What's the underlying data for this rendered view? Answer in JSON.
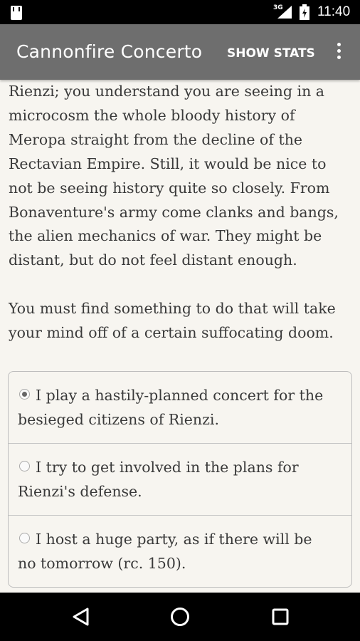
{
  "status_bar": {
    "time": "11:40",
    "network_type": "3G",
    "icons": [
      "sim-card-icon",
      "signal-icon",
      "battery-icon"
    ]
  },
  "app_bar": {
    "title": "Cannonfire Concerto",
    "show_stats_label": "SHOW STATS",
    "overflow_icon": "more-vert-icon",
    "background": "#6e6e6e"
  },
  "story": {
    "paragraphs": [
      [
        "Rienzi; you understand you are seeing in a",
        "microcosm the whole bloody history of",
        "Meropa straight from the decline of the",
        "Rectavian Empire. Still, it would be nice to",
        "not be seeing history quite so closely. From",
        "Bonaventure's army come clanks and bangs,",
        "the alien mechanics of war. They might be",
        "distant, but do not feel distant enough."
      ],
      [
        "You must find something to do that will take",
        "your mind off of a certain suffocating doom."
      ]
    ]
  },
  "choices": [
    {
      "line1": "I play a hastily-planned concert for the",
      "line2": "besieged citizens of Rienzi.",
      "selected": true
    },
    {
      "line1": "I try to get involved in the plans for",
      "line2": "Rienzi's defense.",
      "selected": false
    },
    {
      "line1": "I host a huge party, as if there will be",
      "line2": "no tomorrow (rc. 150).",
      "selected": false
    }
  ],
  "nav_bar": {
    "icons": [
      "back-icon",
      "home-icon",
      "recents-icon"
    ]
  }
}
